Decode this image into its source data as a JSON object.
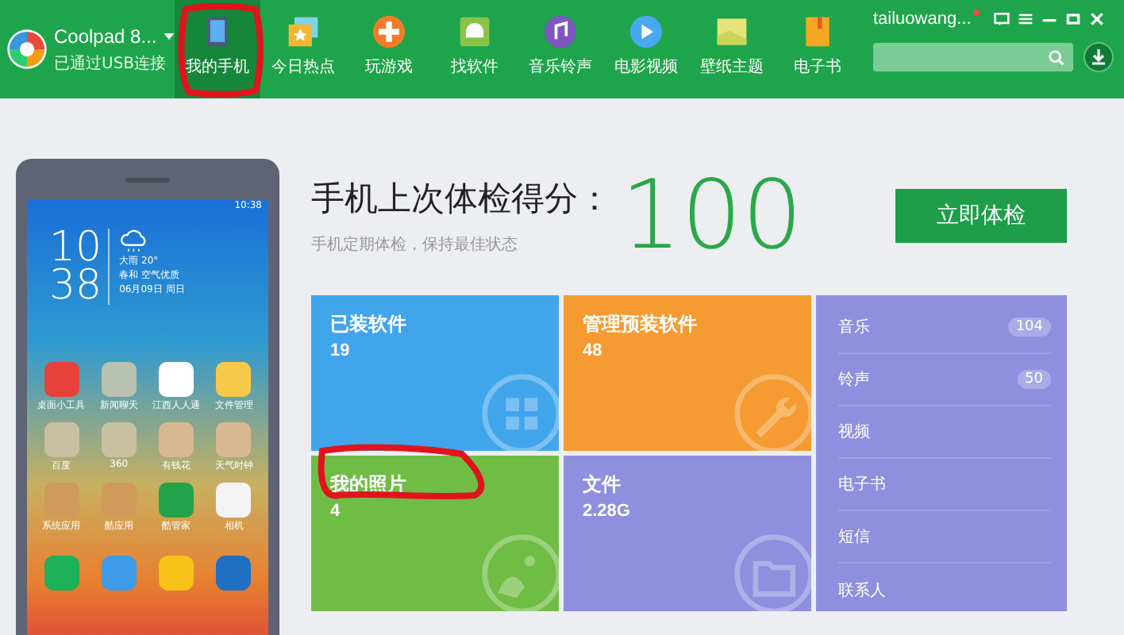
{
  "device": {
    "name": "Coolpad 8...",
    "status": "已通过USB连接"
  },
  "nav": [
    {
      "label": "我的手机",
      "selected": true
    },
    {
      "label": "今日热点",
      "selected": false
    },
    {
      "label": "玩游戏",
      "selected": false
    },
    {
      "label": "找软件",
      "selected": false
    },
    {
      "label": "音乐铃声",
      "selected": false
    },
    {
      "label": "电影视频",
      "selected": false
    },
    {
      "label": "壁纸主题",
      "selected": false
    },
    {
      "label": "电子书",
      "selected": false
    }
  ],
  "account": {
    "user": "tailuowang...",
    "has_notice": true
  },
  "phone": {
    "status_time": "10:38",
    "hour": "10",
    "minute": "38",
    "weather": [
      "大雨 20°",
      "春和 空气优质",
      "06月09日 周日"
    ],
    "apps": [
      {
        "label": "桌面小工具",
        "color": "#e8413c"
      },
      {
        "label": "新闻聊天",
        "color": "#b9c2b0"
      },
      {
        "label": "江西人人通",
        "color": "#ffffff"
      },
      {
        "label": "文件管理",
        "color": "#f7c948"
      },
      {
        "label": "百度",
        "color": "#c8c0a0"
      },
      {
        "label": "360",
        "color": "#c8c0a0"
      },
      {
        "label": "有钱花",
        "color": "#d8b890"
      },
      {
        "label": "天气时钟",
        "color": "#d8b890"
      },
      {
        "label": "系统应用",
        "color": "#d09a5a"
      },
      {
        "label": "酷应用",
        "color": "#d09a5a"
      },
      {
        "label": "酷管家",
        "color": "#22a34a"
      },
      {
        "label": "相机",
        "color": "#f4f4f4"
      }
    ],
    "dock": [
      {
        "color": "#1fb05a"
      },
      {
        "color": "#3d9be9"
      },
      {
        "color": "#f8c21a"
      },
      {
        "color": "#1f6fc2"
      }
    ]
  },
  "score": {
    "title": "手机上次体检得分：",
    "subtitle": "手机定期体检，保持最佳状态",
    "value": "100",
    "button": "立即体检"
  },
  "tiles": [
    {
      "title": "已装软件",
      "value": "19",
      "color": "#41a5ec"
    },
    {
      "title": "管理预装软件",
      "value": "48",
      "color": "#f59b32"
    },
    {
      "title": "我的照片",
      "value": "4",
      "color": "#70bd46"
    },
    {
      "title": "文件",
      "value": "2.28G",
      "color": "#8f8fe0"
    }
  ],
  "media": [
    {
      "label": "音乐",
      "count": "104"
    },
    {
      "label": "铃声",
      "count": "50"
    },
    {
      "label": "视频"
    },
    {
      "label": "电子书"
    },
    {
      "label": "短信"
    },
    {
      "label": "联系人"
    }
  ]
}
